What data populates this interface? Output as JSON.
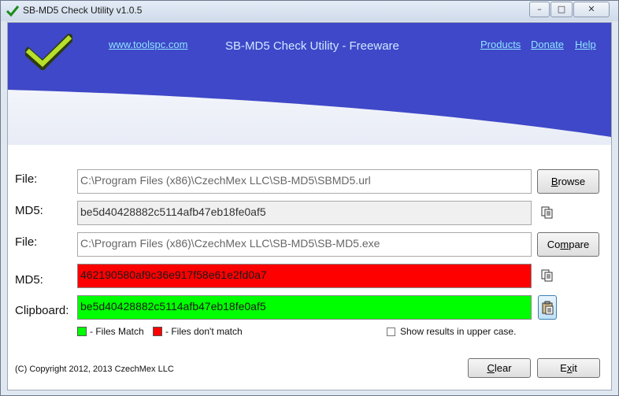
{
  "window": {
    "title": "SB-MD5 Check Utility  v1.0.5",
    "controls": [
      "minimize",
      "maximize",
      "close"
    ]
  },
  "banner": {
    "website_link": "www.toolspc.com",
    "app_title": "SB-MD5 Check Utility - Freeware",
    "nav": {
      "products": "Products",
      "donate": "Donate",
      "help": "Help"
    },
    "gradient_colors": {
      "blue": "#3f48c8",
      "light": "#ffffff"
    },
    "logo_icon": "green-checkmark-icon"
  },
  "rows": {
    "file1": {
      "label": "File:",
      "value": "C:\\Program Files (x86)\\CzechMex LLC\\SB-MD5\\SBMD5.url",
      "button_prefix": "",
      "button_mnemonic": "B",
      "button_rest": "rowse"
    },
    "md5_1": {
      "label": "MD5:",
      "value": "be5d40428882c5114afb47eb18fe0af5",
      "icon": "copy-icon"
    },
    "file2": {
      "label": "File:",
      "value": "C:\\Program Files (x86)\\CzechMex LLC\\SB-MD5\\SB-MD5.exe",
      "button_prefix": "Co",
      "button_mnemonic": "m",
      "button_rest": "pare"
    },
    "md5_2": {
      "label": "MD5:",
      "value": "462190580af9c36e917f58e61e2fd0a7",
      "icon": "copy-icon",
      "status_color": "#ff0000"
    },
    "clipboard": {
      "label": "Clipboard:",
      "value": "be5d40428882c5114afb47eb18fe0af5",
      "icon": "paste-icon",
      "status_color": "#00ff00"
    }
  },
  "legend": {
    "match": {
      "label": "- Files Match",
      "color": "#00ff00"
    },
    "nomatch": {
      "label": "- Files don't match",
      "color": "#ff0000"
    }
  },
  "uppercase_option": {
    "label": "Show results in upper case.",
    "checked": false
  },
  "footer": {
    "copyright": "(C) Copyright 2012, 2013 CzechMex LLC",
    "clear": {
      "mnemonic": "C",
      "rest": "lear"
    },
    "exit": {
      "prefix": "E",
      "mnemonic": "x",
      "rest": "it"
    }
  }
}
